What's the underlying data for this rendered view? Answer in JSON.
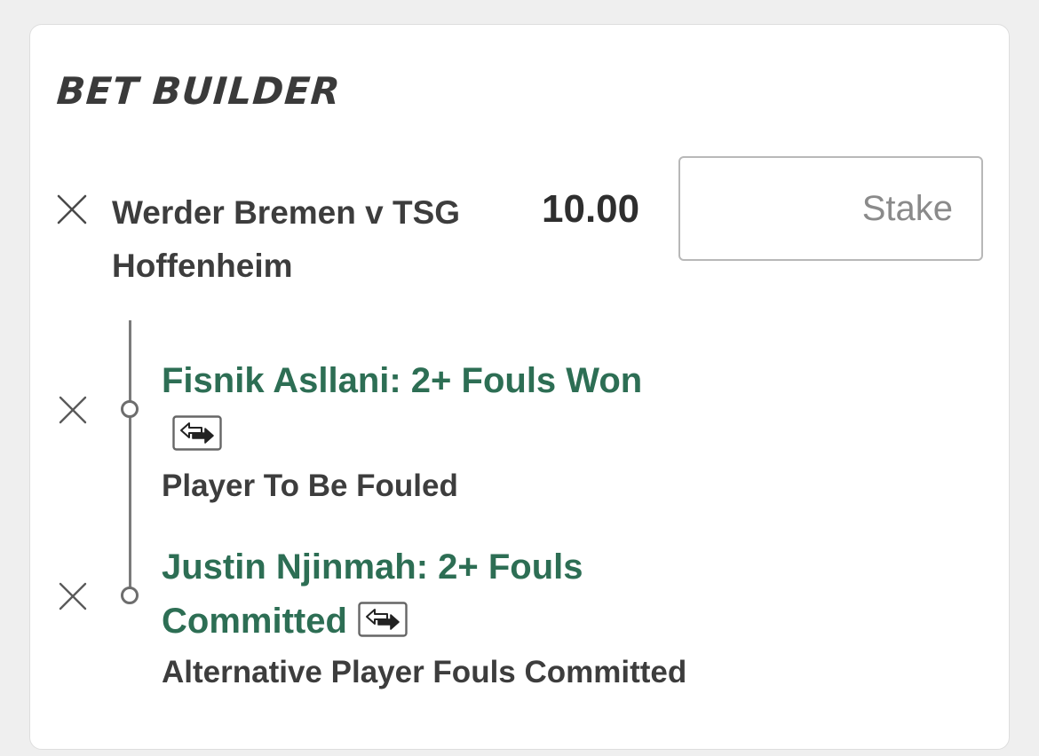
{
  "header": {
    "title": "BET BUILDER"
  },
  "event": {
    "name": "Werder Bremen v TSG Hoffenheim",
    "odds": "10.00",
    "stake_placeholder": "Stake"
  },
  "selections": [
    {
      "title": "Fisnik Asllani: 2+ Fouls Won",
      "market": "Player To Be Fouled"
    },
    {
      "title": "Justin Njinmah: 2+ Fouls Committed",
      "market": "Alternative Player Fouls Committed"
    }
  ],
  "icons": {
    "remove": "close-icon",
    "swap": "swap-arrows-icon"
  },
  "colors": {
    "selection_green": "#2d6e54",
    "text_dark": "#3d3d3d",
    "background": "#efefef"
  }
}
